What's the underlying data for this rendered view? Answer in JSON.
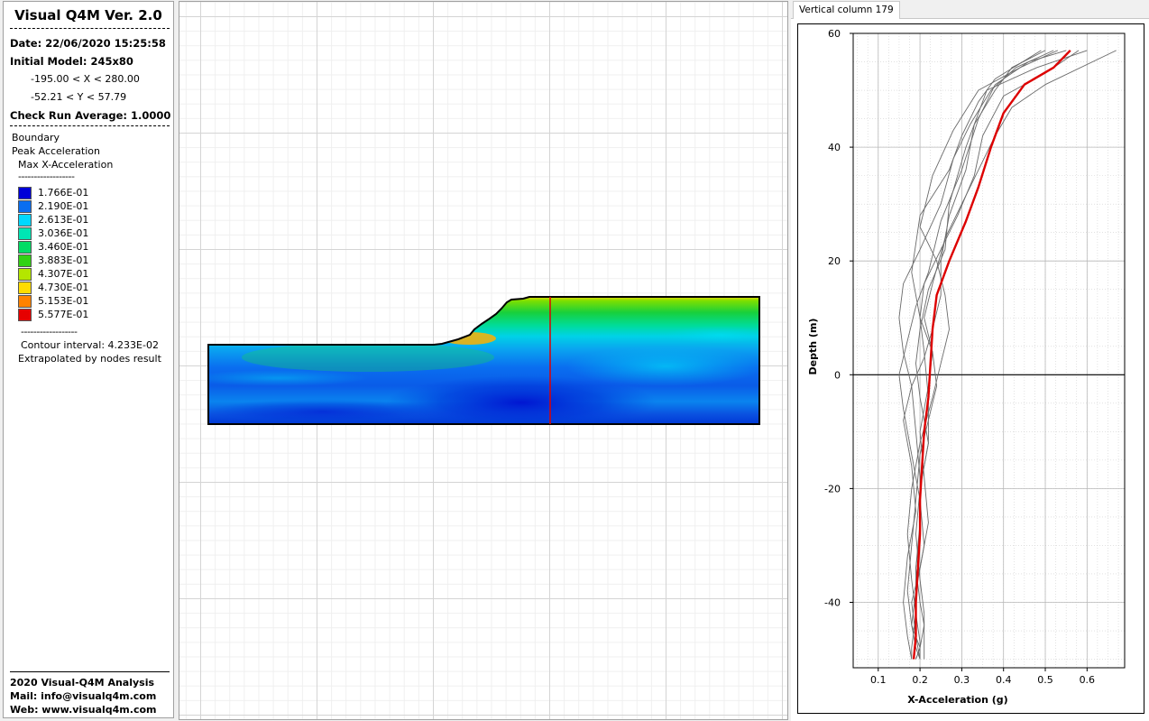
{
  "left_panel": {
    "title": "Visual Q4M Ver. 2.0",
    "date": "Date: 22/06/2020 15:25:58",
    "initial_model": "Initial Model: 245x80",
    "x_range": "-195.00 < X < 280.00",
    "y_range": "-52.21 < Y < 57.79",
    "check_run": "Check Run Average: 1.0000",
    "boundary": "Boundary",
    "peak_acc": "Peak Acceleration",
    "max_x_acc": "Max X-Acceleration",
    "dash_line": "------------------",
    "legend": [
      {
        "label": "1.766E-01",
        "color": "#0000d8"
      },
      {
        "label": "2.190E-01",
        "color": "#0a6ef0"
      },
      {
        "label": "2.613E-01",
        "color": "#00d8ff"
      },
      {
        "label": "3.036E-01",
        "color": "#00e6b4"
      },
      {
        "label": "3.460E-01",
        "color": "#00dc64"
      },
      {
        "label": "3.883E-01",
        "color": "#32d214"
      },
      {
        "label": "4.307E-01",
        "color": "#b4e600"
      },
      {
        "label": "4.730E-01",
        "color": "#ffdc00"
      },
      {
        "label": "5.153E-01",
        "color": "#ff8200"
      },
      {
        "label": "5.577E-01",
        "color": "#e60000"
      }
    ],
    "contour_interval": "Contour interval: 4.233E-02",
    "extrapolated": "Extrapolated by nodes result",
    "footer": {
      "line1": "2020 Visual-Q4M Analysis",
      "line2": "Mail: info@visualq4m.com",
      "line3": "Web: www.visualq4m.com"
    }
  },
  "right_panel": {
    "tab_label": "Vertical column 179"
  },
  "colors": {
    "selected_column": "#e00000",
    "average_curve": "#dd0000",
    "record_curves": "#6a6a6a"
  },
  "chart_data": {
    "type": "line",
    "title": "",
    "xlabel": "X-Acceleration (g)",
    "ylabel": "Depth (m)",
    "xlim": [
      0.04,
      0.69
    ],
    "ylim": [
      -51.5,
      60
    ],
    "xticks": [
      0.1,
      0.2,
      0.3,
      0.4,
      0.5,
      0.6
    ],
    "yticks": [
      -40,
      -20,
      0,
      20,
      40,
      60
    ],
    "grid": true,
    "reference_line_y": 0,
    "average": {
      "x": [
        0.56,
        0.52,
        0.45,
        0.4,
        0.37,
        0.34,
        0.31,
        0.27,
        0.24,
        0.23,
        0.225,
        0.22,
        0.21,
        0.205,
        0.2,
        0.2,
        0.195,
        0.19,
        0.19,
        0.185
      ],
      "y": [
        57,
        54,
        51,
        46,
        40,
        33,
        27,
        20,
        14,
        8,
        2,
        -4,
        -10,
        -16,
        -22,
        -28,
        -34,
        -40,
        -46,
        -50
      ]
    },
    "records": [
      {
        "x": [
          0.6,
          0.48,
          0.36,
          0.31,
          0.27,
          0.26,
          0.22,
          0.2,
          0.19,
          0.2,
          0.22,
          0.2,
          0.2,
          0.19,
          0.2,
          0.21,
          0.2,
          0.19
        ],
        "y": [
          57,
          54,
          50,
          40,
          30,
          22,
          15,
          8,
          2,
          -4,
          -12,
          -20,
          -28,
          -34,
          -40,
          -44,
          -48,
          -50
        ]
      },
      {
        "x": [
          0.5,
          0.42,
          0.38,
          0.33,
          0.31,
          0.27,
          0.25,
          0.25,
          0.23,
          0.21,
          0.18,
          0.16,
          0.18,
          0.19,
          0.17,
          0.16,
          0.17,
          0.18
        ],
        "y": [
          57,
          54,
          50,
          44,
          36,
          28,
          20,
          14,
          8,
          3,
          -2,
          -8,
          -16,
          -24,
          -32,
          -40,
          -46,
          -50
        ]
      },
      {
        "x": [
          0.67,
          0.5,
          0.42,
          0.38,
          0.34,
          0.3,
          0.26,
          0.23,
          0.21,
          0.23,
          0.22,
          0.2,
          0.21,
          0.22,
          0.2,
          0.18,
          0.19,
          0.2
        ],
        "y": [
          57,
          51,
          47,
          42,
          36,
          30,
          24,
          16,
          10,
          4,
          -2,
          -10,
          -18,
          -26,
          -34,
          -40,
          -46,
          -50
        ]
      },
      {
        "x": [
          0.55,
          0.46,
          0.38,
          0.34,
          0.3,
          0.25,
          0.22,
          0.19,
          0.17,
          0.15,
          0.16,
          0.18,
          0.2,
          0.21,
          0.19,
          0.18,
          0.19,
          0.2
        ],
        "y": [
          57,
          55,
          51,
          45,
          36,
          27,
          18,
          12,
          6,
          0,
          -6,
          -14,
          -22,
          -30,
          -38,
          -44,
          -48,
          -50
        ]
      },
      {
        "x": [
          0.58,
          0.5,
          0.4,
          0.35,
          0.33,
          0.29,
          0.25,
          0.21,
          0.2,
          0.21,
          0.22,
          0.22,
          0.2,
          0.19,
          0.2,
          0.21,
          0.21,
          0.21
        ],
        "y": [
          57,
          53,
          49,
          42,
          35,
          28,
          22,
          16,
          10,
          4,
          -4,
          -12,
          -20,
          -28,
          -36,
          -42,
          -48,
          -50
        ]
      },
      {
        "x": [
          0.53,
          0.44,
          0.34,
          0.28,
          0.23,
          0.2,
          0.24,
          0.26,
          0.27,
          0.25,
          0.23,
          0.2,
          0.18,
          0.17,
          0.18,
          0.19,
          0.18,
          0.18
        ],
        "y": [
          57,
          54,
          50,
          43,
          35,
          26,
          20,
          14,
          8,
          2,
          -4,
          -12,
          -20,
          -28,
          -36,
          -42,
          -48,
          -50
        ]
      },
      {
        "x": [
          0.49,
          0.38,
          0.34,
          0.3,
          0.27,
          0.2,
          0.18,
          0.2,
          0.23,
          0.24,
          0.22,
          0.2,
          0.19,
          0.18,
          0.17,
          0.18,
          0.2,
          0.19
        ],
        "y": [
          57,
          52,
          48,
          42,
          36,
          28,
          18,
          10,
          4,
          -2,
          -8,
          -14,
          -22,
          -30,
          -38,
          -44,
          -48,
          -50
        ]
      },
      {
        "x": [
          0.52,
          0.43,
          0.37,
          0.32,
          0.28,
          0.25,
          0.2,
          0.16,
          0.15,
          0.16,
          0.18,
          0.19,
          0.2,
          0.2,
          0.19,
          0.19,
          0.2,
          0.2
        ],
        "y": [
          57,
          54,
          50,
          44,
          38,
          30,
          22,
          16,
          10,
          4,
          -2,
          -10,
          -18,
          -26,
          -34,
          -42,
          -47,
          -50
        ]
      }
    ]
  }
}
